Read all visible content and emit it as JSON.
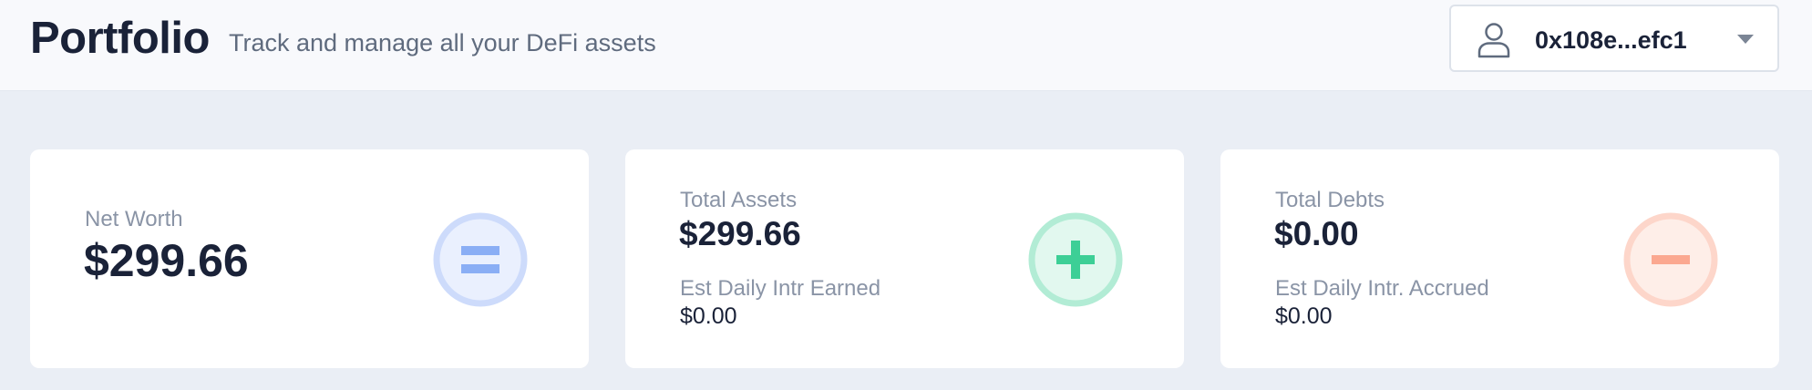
{
  "header": {
    "title": "Portfolio",
    "subtitle": "Track and manage all your DeFi assets",
    "wallet": {
      "address": "0x108e...efc1",
      "icon": "user-icon",
      "caret_icon": "caret-down-icon"
    }
  },
  "cards": {
    "net_worth": {
      "label": "Net Worth",
      "value": "$299.66",
      "icon": "equals-icon",
      "accent": "#8aaef5"
    },
    "total_assets": {
      "label": "Total Assets",
      "value": "$299.66",
      "sub_label": "Est Daily Intr Earned",
      "sub_value": "$0.00",
      "icon": "plus-icon",
      "accent": "#3dcf96"
    },
    "total_debts": {
      "label": "Total Debts",
      "value": "$0.00",
      "sub_label": "Est Daily Intr. Accrued",
      "sub_value": "$0.00",
      "icon": "minus-icon",
      "accent": "#fba890"
    }
  },
  "colors": {
    "page_bg": "#eaeef5",
    "header_bg": "#f8f9fc",
    "text_primary": "#1a2238",
    "text_muted": "#8a94a6"
  }
}
